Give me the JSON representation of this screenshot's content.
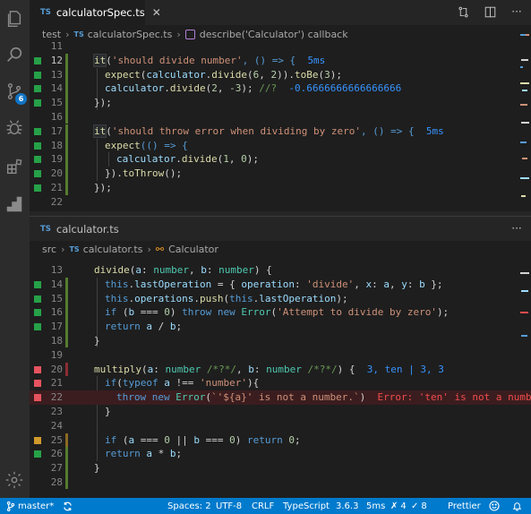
{
  "top": {
    "tab": {
      "lang": "TS",
      "title": "calculatorSpec.ts",
      "close": "✕"
    },
    "breadcrumb": {
      "folder": "test",
      "lang": "TS",
      "file": "calculatorSpec.ts",
      "symbol": "describe('Calculator') callback"
    },
    "lines": [
      {
        "n": "11",
        "mark": ""
      },
      {
        "n": "12",
        "mark": "green"
      },
      {
        "n": "13",
        "mark": "green"
      },
      {
        "n": "14",
        "mark": "green"
      },
      {
        "n": "15",
        "mark": "green"
      },
      {
        "n": "16",
        "mark": ""
      },
      {
        "n": "17",
        "mark": "green"
      },
      {
        "n": "18",
        "mark": "green"
      },
      {
        "n": "19",
        "mark": "green"
      },
      {
        "n": "20",
        "mark": "green"
      },
      {
        "n": "21",
        "mark": "green"
      },
      {
        "n": "22",
        "mark": ""
      }
    ],
    "code": {
      "l12_it": "it",
      "l12_str": "'should divide number'",
      "l12_rest": ", () => {",
      "l12_ann": "5ms",
      "l13_a": "expect",
      "l13_b": "calculator",
      "l13_c": "divide",
      "l13_d": "6",
      "l13_e": "2",
      "l13_f": "toBe",
      "l13_g": "3",
      "l14_a": "calculator",
      "l14_b": "divide",
      "l14_c": "2",
      "l14_d": "-3",
      "l14_cmt": "//?",
      "l14_val": "-0.6666666666666666",
      "l15": "});",
      "l17_it": "it",
      "l17_str": "'should throw error when dividing by zero'",
      "l17_rest": ", () => {",
      "l17_ann": "5ms",
      "l18_a": "expect",
      "l18_b": "(() => {",
      "l19_a": "calculator",
      "l19_b": "divide",
      "l19_c": "1",
      "l19_d": "0",
      "l20_a": "}).",
      "l20_b": "toThrow",
      "l20_c": "();",
      "l21": "});"
    }
  },
  "bottom": {
    "tab": {
      "lang": "TS",
      "title": "calculator.ts"
    },
    "breadcrumb": {
      "folder": "src",
      "lang": "TS",
      "file": "calculator.ts",
      "symbol": "Calculator"
    },
    "lines": [
      {
        "n": "13",
        "mark": ""
      },
      {
        "n": "14",
        "mark": "green"
      },
      {
        "n": "15",
        "mark": "green"
      },
      {
        "n": "16",
        "mark": "green"
      },
      {
        "n": "17",
        "mark": "green"
      },
      {
        "n": "18",
        "mark": ""
      },
      {
        "n": "19",
        "mark": ""
      },
      {
        "n": "20",
        "mark": "red"
      },
      {
        "n": "21",
        "mark": "red"
      },
      {
        "n": "22",
        "mark": "red"
      },
      {
        "n": "23",
        "mark": ""
      },
      {
        "n": "24",
        "mark": ""
      },
      {
        "n": "25",
        "mark": "orange"
      },
      {
        "n": "26",
        "mark": "green"
      },
      {
        "n": "27",
        "mark": ""
      },
      {
        "n": "28",
        "mark": ""
      }
    ],
    "code": {
      "l13_fn": "divide",
      "l13_p1": "a",
      "l13_t1": "number",
      "l13_p2": "b",
      "l13_t2": "number",
      "l14_a": "this",
      "l14_b": "lastOperation",
      "l14_c": "operation",
      "l14_d": "'divide'",
      "l14_e": "x",
      "l14_f": "a",
      "l14_g": "y",
      "l14_h": "b",
      "l15_a": "this",
      "l15_b": "operations",
      "l15_c": "push",
      "l15_d": "this",
      "l15_e": "lastOperation",
      "l16_a": "if",
      "l16_b": "b",
      "l16_c": "0",
      "l16_d": "throw",
      "l16_e": "new",
      "l16_f": "Error",
      "l16_g": "'Attempt to divide by zero'",
      "l17_a": "return",
      "l17_b": "a",
      "l17_c": "b",
      "l18": "}",
      "l20_fn": "multiply",
      "l20_p1": "a",
      "l20_t1": "number",
      "l20_c1": "/*?*/",
      "l20_p2": "b",
      "l20_t2": "number",
      "l20_c2": "/*?*/",
      "l20_ann": "3, ten | 3, 3",
      "l21_a": "if",
      "l21_b": "typeof",
      "l21_c": "a",
      "l21_d": "'number'",
      "l22_a": "throw",
      "l22_b": "new",
      "l22_c": "Error",
      "l22_d": "`'${a}' is not a number.`",
      "l22_err": "Error: 'ten' is not a number",
      "l23": "}",
      "l25_a": "if",
      "l25_b": "a",
      "l25_c": "0",
      "l25_d": "b",
      "l25_e": "0",
      "l25_f": "return",
      "l25_g": "0",
      "l26_a": "return",
      "l26_b": "a",
      "l26_c": "b",
      "l27": "}"
    }
  },
  "statusbar": {
    "branch": "master*",
    "spaces": "Spaces: 2",
    "encoding": "UTF-8",
    "eol": "CRLF",
    "language": "TypeScript",
    "version": "3.6.3",
    "time": "5ms",
    "failed": "4",
    "passed": "8",
    "formatter": "Prettier"
  },
  "activity_bar": {
    "icons": [
      "files-icon",
      "search-icon",
      "source-control-icon",
      "debug-icon",
      "extensions-icon",
      "quokka-icon",
      "settings-gear-icon"
    ],
    "scm_badge": "6"
  },
  "colors": {
    "accent": "#007acc",
    "covered": "#26a148",
    "uncovered": "#e5535e",
    "partial": "#d29a2c"
  }
}
